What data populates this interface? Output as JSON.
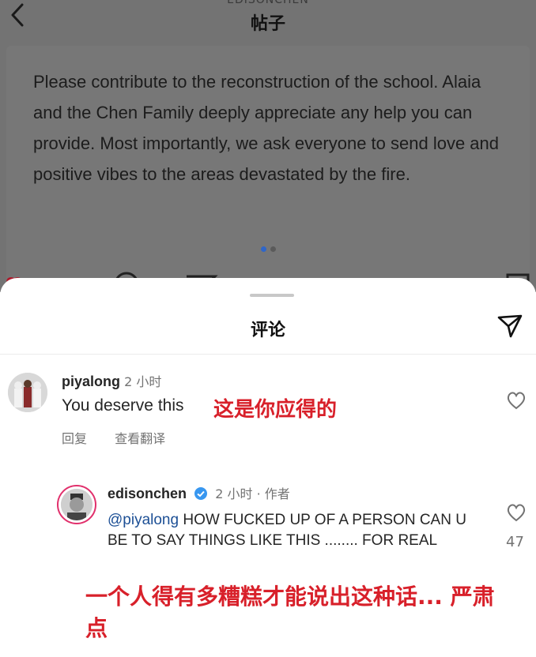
{
  "header": {
    "username": "EDISONCHEN",
    "title": "帖子"
  },
  "post": {
    "text": "Please contribute to the reconstruction of the school. Alaia and the Chen Family deeply appreciate any help you can provide. Most importantly, we ask everyone to send love and positive vibes to the areas devastated by the fire.",
    "carousel_index": 1,
    "carousel_total": 2
  },
  "comments_sheet": {
    "title": "评论",
    "comments": [
      {
        "username": "piyalong",
        "time": "2 小时",
        "text": "You deserve this",
        "translation_overlay": "这是你应得的",
        "reply_label": "回复",
        "translate_label": "查看翻译"
      },
      {
        "username": "edisonchen",
        "time": "2 小时 · 作者",
        "mention": "@piyalong",
        "text": " HOW FUCKED UP OF A PERSON CAN U BE TO SAY THINGS LIKE THIS ........ FOR REAL",
        "likes": "47",
        "translation_overlay": "一个人得有多糟糕才能说出这种话... 严肃点"
      }
    ]
  },
  "colors": {
    "overlay_translation": "#d8202a",
    "mention": "#1c4f95",
    "verified": "#3897f0"
  }
}
